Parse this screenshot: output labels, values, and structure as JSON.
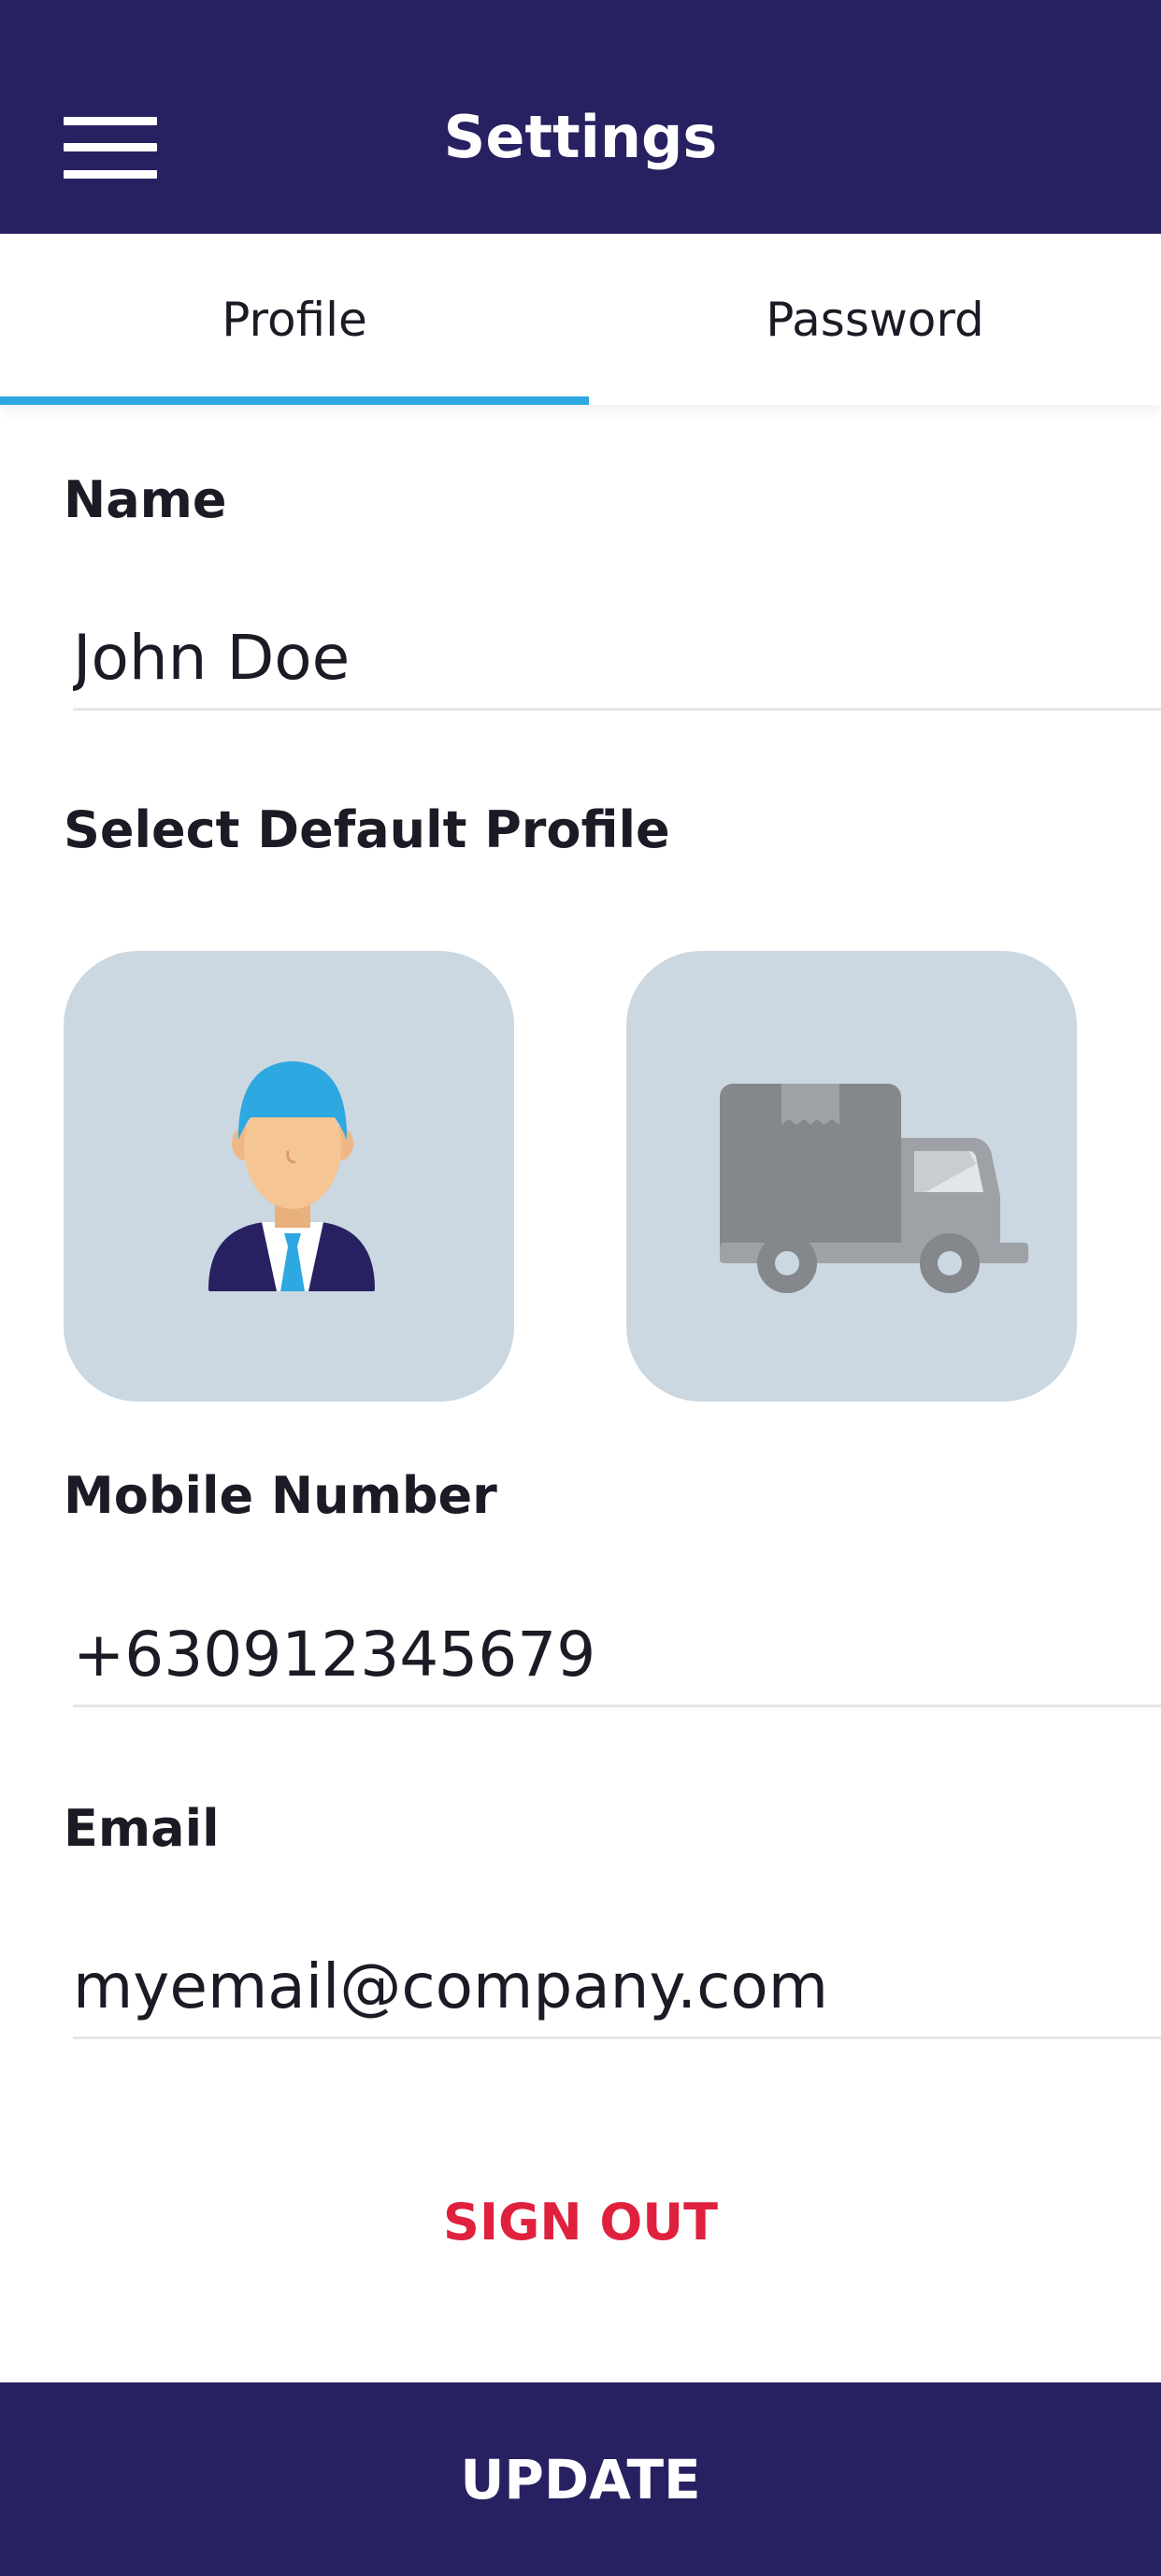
{
  "header": {
    "title": "Settings",
    "menu_icon": "hamburger-menu-icon"
  },
  "tabs": [
    {
      "label": "Profile",
      "active": true
    },
    {
      "label": "Password",
      "active": false
    }
  ],
  "form": {
    "name": {
      "label": "Name",
      "value": "John Doe"
    },
    "default_profile": {
      "label": "Select Default Profile",
      "options": [
        {
          "icon": "person-avatar-icon"
        },
        {
          "icon": "delivery-truck-icon"
        }
      ]
    },
    "mobile": {
      "label": "Mobile Number",
      "value": "+630912345679"
    },
    "email": {
      "label": "Email",
      "value": "myemail@company.com"
    }
  },
  "actions": {
    "sign_out": "SIGN OUT",
    "update": "UPDATE"
  },
  "colors": {
    "header_bg": "#272161",
    "tab_indicator": "#2ea8e0",
    "card_bg": "#cbd7e1",
    "sign_out": "#e0213e"
  }
}
